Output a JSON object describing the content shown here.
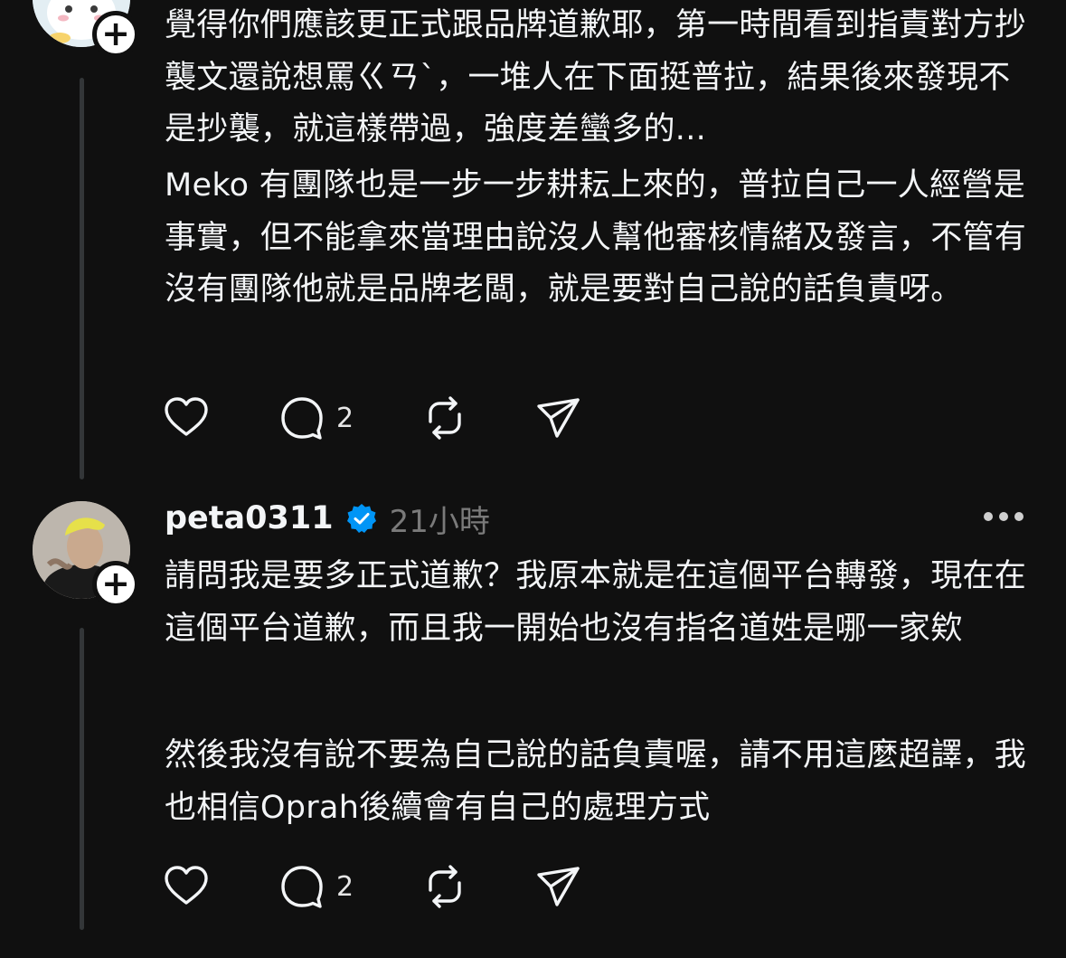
{
  "comment1": {
    "paragraphs": [
      "覺得你們應該更正式跟品牌道歉耶，第一時間看到指責對方抄襲文還說想罵ㄍㄢˋ，一堆人在下面挺普拉，結果後來發現不是抄襲，就這樣帶過，強度差蠻多的...",
      "Meko 有團隊也是一步一步耕耘上來的，普拉自己一人經營是事實，但不能拿來當理由說沒人幫他審核情緒及發言，不管有沒有團隊他就是品牌老闆，就是要對自己說的話負責呀。"
    ],
    "actions": {
      "reply_count": "2"
    }
  },
  "comment2": {
    "username": "peta0311",
    "timestamp": "21小時",
    "paragraphs": [
      "請問我是要多正式道歉？我原本就是在這個平台轉發，現在在這個平台道歉，而且我一開始也沒有指名道姓是哪一家欸",
      "然後我沒有說不要為自己說的話負責喔，請不用這麼超譯，我也相信Oprah後續會有自己的處理方式"
    ],
    "actions": {
      "reply_count": "2"
    }
  },
  "icons": {
    "like": "heart-icon",
    "reply": "comment-icon",
    "repost": "repost-icon",
    "share": "send-icon",
    "verified": "verified-badge-icon",
    "more": "more-options-icon",
    "follow": "plus-icon"
  },
  "colors": {
    "background": "#101010",
    "text": "#f3f5f7",
    "muted": "#7a7a7a",
    "verified": "#0095f6",
    "thread_line": "#333638"
  }
}
